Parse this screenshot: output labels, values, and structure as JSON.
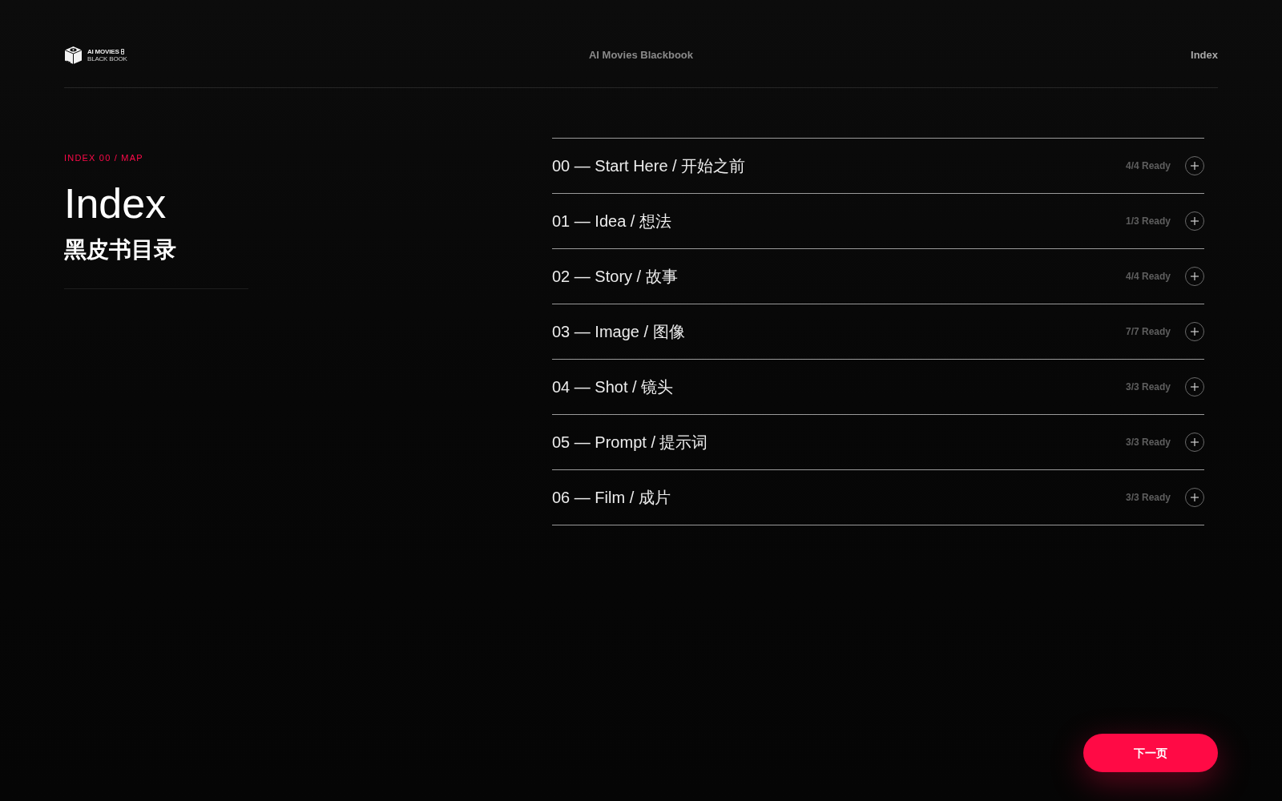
{
  "header": {
    "logo": {
      "line_1": "AI MOVIES",
      "line_2": "BLACK BOOK"
    },
    "title": "AI Movies Blackbook",
    "nav_link": "Index"
  },
  "intro": {
    "eyebrow": "INDEX 00 / MAP",
    "title": "Index",
    "subtitle": "黑皮书目录"
  },
  "sections": [
    {
      "title": "00 — Start Here / 开始之前",
      "status": "4/4 Ready",
      "expanded": false
    },
    {
      "title": "01 — Idea / 想法",
      "status": "1/3 Ready",
      "expanded": false
    },
    {
      "title": "02 — Story / 故事",
      "status": "4/4 Ready",
      "expanded": false
    },
    {
      "title": "03 — Image / 图像",
      "status": "7/7 Ready",
      "expanded": false
    },
    {
      "title": "04 — Shot / 镜头",
      "status": "3/3 Ready",
      "expanded": false
    },
    {
      "title": "05 — Prompt / 提示词",
      "status": "3/3 Ready",
      "expanded": false
    },
    {
      "title": "06 — Film / 成片",
      "status": "3/3 Ready",
      "expanded": false
    }
  ],
  "next_button": "下一页"
}
